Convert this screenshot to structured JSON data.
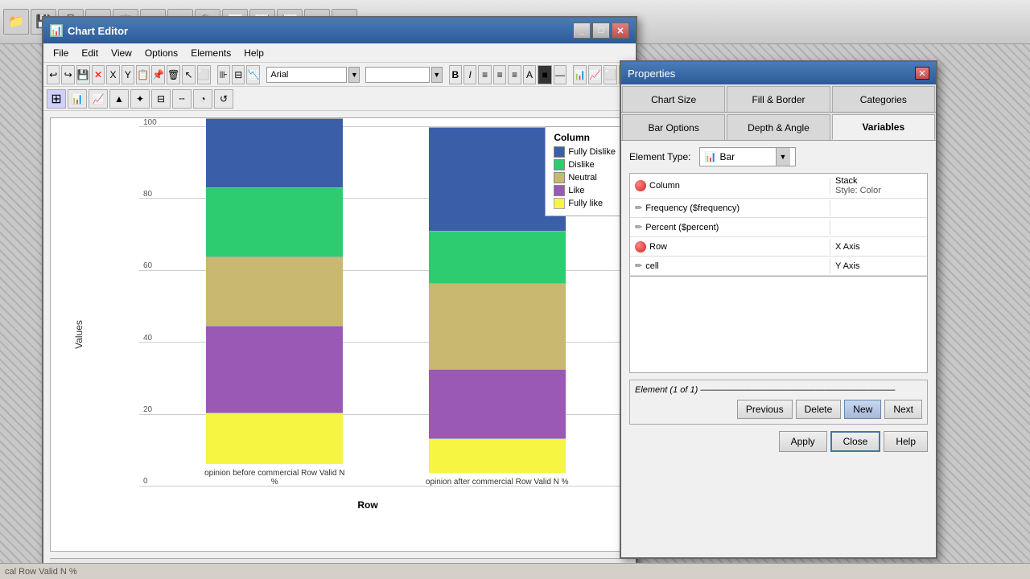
{
  "taskbar": {
    "icons": [
      "📁",
      "💾",
      "🖨",
      "✂",
      "📋",
      "↩",
      "↪",
      "🔍",
      "📊",
      "📈"
    ]
  },
  "chart_editor": {
    "title": "Chart Editor",
    "menu": {
      "items": [
        "File",
        "Edit",
        "View",
        "Options",
        "Elements",
        "Help"
      ]
    },
    "chart": {
      "y_axis_label": "Values",
      "x_axis_label": "Row",
      "y_ticks": [
        "0",
        "20",
        "40",
        "60",
        "80",
        "100"
      ],
      "bars": [
        {
          "label": "opinion before commercial Row Valid N %",
          "segments": [
            {
              "color": "#f5f542",
              "height_pct": 15,
              "label": "Fully like"
            },
            {
              "color": "#9b59b6",
              "height_pct": 25,
              "label": "Like"
            },
            {
              "color": "#c8b870",
              "height_pct": 20,
              "label": "Neutral"
            },
            {
              "color": "#2ecc71",
              "height_pct": 20,
              "label": "Dislike"
            },
            {
              "color": "#3a5fa8",
              "height_pct": 20,
              "label": "Fully Dislike"
            }
          ]
        },
        {
          "label": "opinion after commercial Row Valid N %",
          "segments": [
            {
              "color": "#f5f542",
              "height_pct": 10,
              "label": "Fully like"
            },
            {
              "color": "#9b59b6",
              "height_pct": 20,
              "label": "Like"
            },
            {
              "color": "#c8b870",
              "height_pct": 25,
              "label": "Neutral"
            },
            {
              "color": "#2ecc71",
              "height_pct": 15,
              "label": "Dislike"
            },
            {
              "color": "#3a5fa8",
              "height_pct": 30,
              "label": "Fully Dislike"
            }
          ]
        }
      ],
      "legend": {
        "title": "Column",
        "items": [
          {
            "color": "#3a5fa8",
            "label": "Fully Dislike"
          },
          {
            "color": "#2ecc71",
            "label": "Dislike"
          },
          {
            "color": "#c8b870",
            "label": "Neutral"
          },
          {
            "color": "#9b59b6",
            "label": "Like"
          },
          {
            "color": "#f5f542",
            "label": "Fully like"
          }
        ]
      }
    }
  },
  "properties": {
    "title": "Properties",
    "tabs_row1": [
      "Chart Size",
      "Fill & Border",
      "Categories"
    ],
    "tabs_row2": [
      "Bar Options",
      "Depth & Angle",
      "Variables"
    ],
    "active_tab": "Variables",
    "element_type": {
      "label": "Element Type:",
      "value": "Bar",
      "icon": "📊"
    },
    "table": {
      "col_name": "",
      "col_role": "",
      "stack_label": "Stack",
      "style_label": "Style: Color",
      "rows": [
        {
          "icon": "ball-red",
          "name": "Column",
          "role": "Stack\nStyle: Color"
        },
        {
          "icon": "pencil",
          "name": "Frequency ($frequency)",
          "role": ""
        },
        {
          "icon": "pencil",
          "name": "Percent ($percent)",
          "role": ""
        },
        {
          "icon": "ball-red",
          "name": "Row",
          "role": "X Axis"
        },
        {
          "icon": "pencil",
          "name": "cell",
          "role": "Y Axis"
        }
      ]
    },
    "element_section": {
      "title": "Element (1 of 1)",
      "buttons": [
        "Previous",
        "Delete",
        "New",
        "Next"
      ]
    },
    "bottom_buttons": [
      "Apply",
      "Close",
      "Help"
    ]
  }
}
